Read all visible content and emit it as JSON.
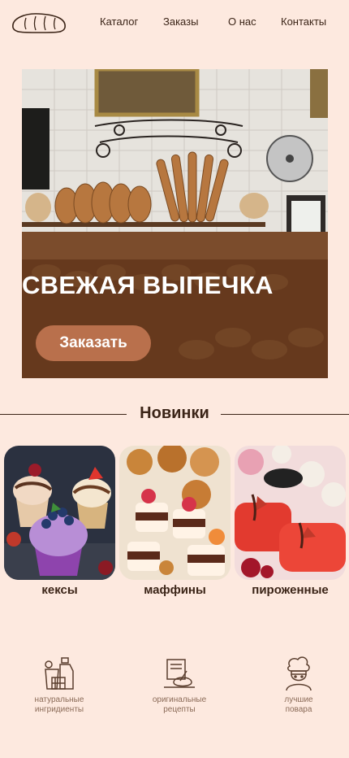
{
  "nav": {
    "logo_icon": "bread-loaf-icon",
    "items": [
      "Каталог",
      "Заказы",
      "О нас",
      "Контакты"
    ]
  },
  "hero": {
    "title": "СВЕЖАЯ ВЫПЕЧКА",
    "button_label": "Заказать"
  },
  "new_items": {
    "title": "Новинки",
    "cards": [
      {
        "label": "кексы",
        "image": "cupcakes-photo"
      },
      {
        "label": "маффины",
        "image": "muffins-photo"
      },
      {
        "label": "пироженные",
        "image": "pastries-photo"
      }
    ]
  },
  "features": [
    {
      "text": "натуральные\nингридиенты",
      "icon": "ingredients-icon"
    },
    {
      "text": "оригинальные\nрецепты",
      "icon": "recipe-book-icon"
    },
    {
      "text": "лучшие\nповара",
      "icon": "chef-icon"
    }
  ],
  "colors": {
    "background": "#fde9df",
    "text": "#3b2417",
    "accent": "#b9704c",
    "muted": "#8b6b58"
  }
}
